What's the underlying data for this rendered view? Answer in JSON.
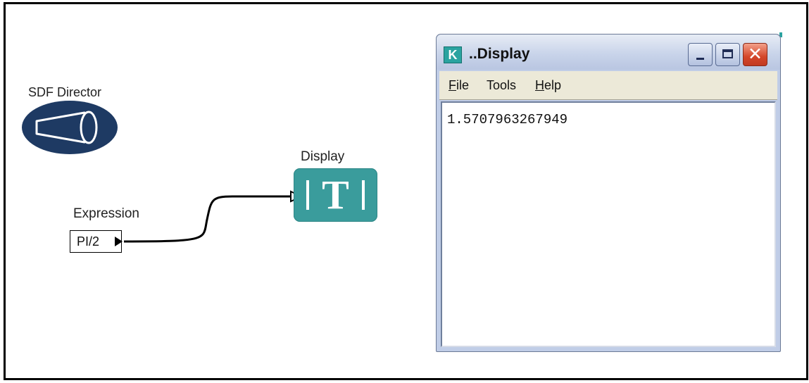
{
  "canvas": {
    "director": {
      "label": "SDF Director",
      "icon": "sdf-director-icon"
    },
    "display_actor": {
      "label": "Display",
      "icon_text": "T",
      "color": "#3a9c9c"
    },
    "expression_actor": {
      "label": "Expression",
      "value": "PI/2"
    }
  },
  "window": {
    "app_icon_letter": "K",
    "title": "..Display",
    "buttons": {
      "minimize": "minimize-icon",
      "maximize": "maximize-icon",
      "close": "✕"
    },
    "menu": {
      "file": {
        "accel": "F",
        "rest": "ile"
      },
      "tools": {
        "label": "Tools"
      },
      "help": {
        "accel": "H",
        "rest": "elp"
      }
    },
    "output": "1.5707963267949"
  },
  "colors": {
    "accent_teal": "#2aa3a0",
    "director_blue": "#1e3a63",
    "close_red": "#d4462a"
  }
}
